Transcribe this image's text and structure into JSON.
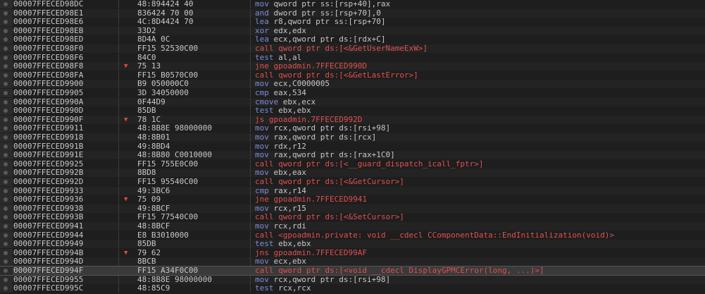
{
  "rows": [
    {
      "addr": "00007FFECED98DC",
      "bytes": "48:894424 40",
      "mnemonic": "mov",
      "operands": "qword ptr ss:[rsp+40],rax",
      "kind": "normal"
    },
    {
      "addr": "00007FFECED98E1",
      "bytes": "836424 70 00",
      "mnemonic": "and",
      "operands": "dword ptr ss:[rsp+70],0",
      "kind": "normal"
    },
    {
      "addr": "00007FFECED98E6",
      "bytes": "4C:8D4424 70",
      "mnemonic": "lea",
      "operands": "r8,qword ptr ss:[rsp+70]",
      "kind": "normal"
    },
    {
      "addr": "00007FFECED98EB",
      "bytes": "33D2",
      "mnemonic": "xor",
      "operands": "edx,edx",
      "kind": "normal"
    },
    {
      "addr": "00007FFECED98ED",
      "bytes": "8D4A 0C",
      "mnemonic": "lea",
      "operands": "ecx,qword ptr ds:[rdx+C]",
      "kind": "normal"
    },
    {
      "addr": "00007FFECED98F0",
      "bytes": "FF15 52530C00",
      "mnemonic": "call",
      "operands": "qword ptr ds:[<&GetUserNameExW>]",
      "kind": "call"
    },
    {
      "addr": "00007FFECED98F6",
      "bytes": "84C0",
      "mnemonic": "test",
      "operands": "al,al",
      "kind": "normal"
    },
    {
      "addr": "00007FFECED98F8",
      "bytes": "75 13",
      "mnemonic": "jne",
      "operands": "gpoadmin.7FFECED990D",
      "kind": "jmp",
      "arrow": "▼"
    },
    {
      "addr": "00007FFECED98FA",
      "bytes": "FF15 B0570C00",
      "mnemonic": "call",
      "operands": "qword ptr ds:[<&GetLastError>]",
      "kind": "call"
    },
    {
      "addr": "00007FFECED9900",
      "bytes": "B9 050000C0",
      "mnemonic": "mov",
      "operands": "ecx,C0000005",
      "kind": "normal"
    },
    {
      "addr": "00007FFECED9905",
      "bytes": "3D 34050000",
      "mnemonic": "cmp",
      "operands": "eax,534",
      "kind": "normal"
    },
    {
      "addr": "00007FFECED990A",
      "bytes": "0F44D9",
      "mnemonic": "cmove",
      "operands": "ebx,ecx",
      "kind": "normal"
    },
    {
      "addr": "00007FFECED990D",
      "bytes": "85DB",
      "mnemonic": "test",
      "operands": "ebx,ebx",
      "kind": "normal"
    },
    {
      "addr": "00007FFECED990F",
      "bytes": "78 1C",
      "mnemonic": "js",
      "operands": "gpoadmin.7FFECED992D",
      "kind": "jmp",
      "arrow": "▼"
    },
    {
      "addr": "00007FFECED9911",
      "bytes": "48:8B8E 98000000",
      "mnemonic": "mov",
      "operands": "rcx,qword ptr ds:[rsi+98]",
      "kind": "normal"
    },
    {
      "addr": "00007FFECED9918",
      "bytes": "48:8B01",
      "mnemonic": "mov",
      "operands": "rax,qword ptr ds:[rcx]",
      "kind": "normal"
    },
    {
      "addr": "00007FFECED991B",
      "bytes": "49:8BD4",
      "mnemonic": "mov",
      "operands": "rdx,r12",
      "kind": "normal"
    },
    {
      "addr": "00007FFECED991E",
      "bytes": "48:8B80 C0010000",
      "mnemonic": "mov",
      "operands": "rax,qword ptr ds:[rax+1C0]",
      "kind": "normal"
    },
    {
      "addr": "00007FFECED9925",
      "bytes": "FF15 755E0C00",
      "mnemonic": "call",
      "operands": "qword ptr ds:[<__guard_dispatch_icall_fptr>]",
      "kind": "call"
    },
    {
      "addr": "00007FFECED992B",
      "bytes": "8BD8",
      "mnemonic": "mov",
      "operands": "ebx,eax",
      "kind": "normal"
    },
    {
      "addr": "00007FFECED992D",
      "bytes": "FF15 95540C00",
      "mnemonic": "call",
      "operands": "qword ptr ds:[<&GetCursor>]",
      "kind": "call"
    },
    {
      "addr": "00007FFECED9933",
      "bytes": "49:3BC6",
      "mnemonic": "cmp",
      "operands": "rax,r14",
      "kind": "normal"
    },
    {
      "addr": "00007FFECED9936",
      "bytes": "75 09",
      "mnemonic": "jne",
      "operands": "gpoadmin.7FFECED9941",
      "kind": "jmp",
      "arrow": "▼"
    },
    {
      "addr": "00007FFECED9938",
      "bytes": "49:8BCF",
      "mnemonic": "mov",
      "operands": "rcx,r15",
      "kind": "normal"
    },
    {
      "addr": "00007FFECED993B",
      "bytes": "FF15 77540C00",
      "mnemonic": "call",
      "operands": "qword ptr ds:[<&SetCursor>]",
      "kind": "call"
    },
    {
      "addr": "00007FFECED9941",
      "bytes": "48:8BCF",
      "mnemonic": "mov",
      "operands": "rcx,rdi",
      "kind": "normal"
    },
    {
      "addr": "00007FFECED9944",
      "bytes": "E8 B3010000",
      "mnemonic": "call",
      "operands": "<gpoadmin.private: void __cdecl CComponentData::EndInitialization(void)>",
      "kind": "call"
    },
    {
      "addr": "00007FFECED9949",
      "bytes": "85DB",
      "mnemonic": "test",
      "operands": "ebx,ebx",
      "kind": "normal"
    },
    {
      "addr": "00007FFECED994B",
      "bytes": "79 62",
      "mnemonic": "jns",
      "operands": "gpoadmin.7FFECED99AF",
      "kind": "jmp",
      "arrow": "▼"
    },
    {
      "addr": "00007FFECED994D",
      "bytes": "8BCB",
      "mnemonic": "mov",
      "operands": "ecx,ebx",
      "kind": "normal"
    },
    {
      "addr": "00007FFECED994F",
      "bytes": "FF15 A34F0C00",
      "mnemonic": "call",
      "operands": "qword ptr ds:[<void __cdecl DisplayGPMCError(long, ...)>]",
      "kind": "call",
      "selected": true
    },
    {
      "addr": "00007FFECED9955",
      "bytes": "48:8B8E 98000000",
      "mnemonic": "mov",
      "operands": "rcx,qword ptr ds:[rsi+98]",
      "kind": "normal"
    },
    {
      "addr": "00007FFECED995C",
      "bytes": "48:85C9",
      "mnemonic": "test",
      "operands": "rcx,rcx",
      "kind": "normal"
    }
  ]
}
